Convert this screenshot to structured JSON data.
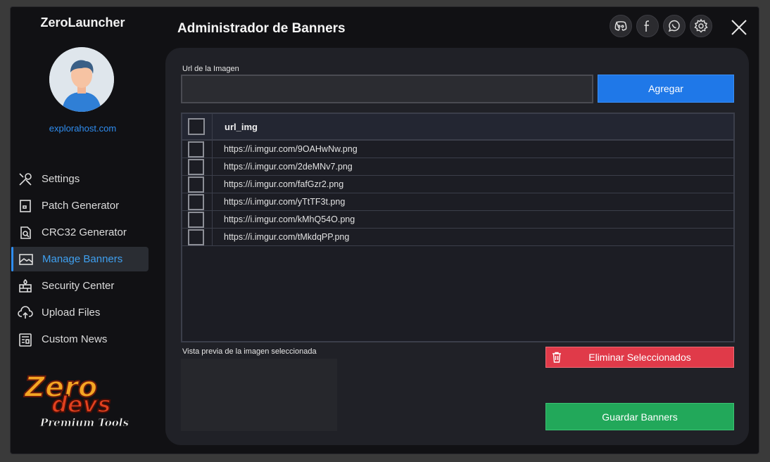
{
  "app": {
    "title": "ZeroLauncher",
    "domain": "explorahost.com"
  },
  "header": {
    "title": "Administrador de Banners"
  },
  "social": [
    {
      "name": "discord-icon"
    },
    {
      "name": "facebook-icon"
    },
    {
      "name": "whatsapp-icon"
    },
    {
      "name": "settings-gear-icon"
    }
  ],
  "sidebar": {
    "items": [
      {
        "label": "Settings",
        "icon": "tools-icon"
      },
      {
        "label": "Patch Generator",
        "icon": "patch-icon"
      },
      {
        "label": "CRC32 Generator",
        "icon": "crc-icon"
      },
      {
        "label": "Manage Banners",
        "icon": "image-icon",
        "active": true
      },
      {
        "label": "Security Center",
        "icon": "firewall-icon"
      },
      {
        "label": "Upload Files",
        "icon": "cloud-upload-icon"
      },
      {
        "label": "Custom News",
        "icon": "news-icon"
      }
    ]
  },
  "logo": {
    "line1": "Zero",
    "line2": "devs",
    "line3": "Premium Tools"
  },
  "form": {
    "url_label": "Url de la Imagen",
    "url_value": "",
    "add_label": "Agregar"
  },
  "table": {
    "header": "url_img",
    "rows": [
      "https://i.imgur.com/9OAHwNw.png",
      "https://i.imgur.com/2deMNv7.png",
      "https://i.imgur.com/fafGzr2.png",
      "https://i.imgur.com/yTtTF3t.png",
      "https://i.imgur.com/kMhQ54O.png",
      "https://i.imgur.com/tMkdqPP.png"
    ]
  },
  "preview": {
    "label": "Vista previa de la imagen seleccionada"
  },
  "actions": {
    "delete_label": "Eliminar Seleccionados",
    "save_label": "Guardar Banners"
  },
  "colors": {
    "accent": "#1f78e8",
    "danger": "#e03a49",
    "success": "#22a85a",
    "link": "#2f8df0"
  }
}
